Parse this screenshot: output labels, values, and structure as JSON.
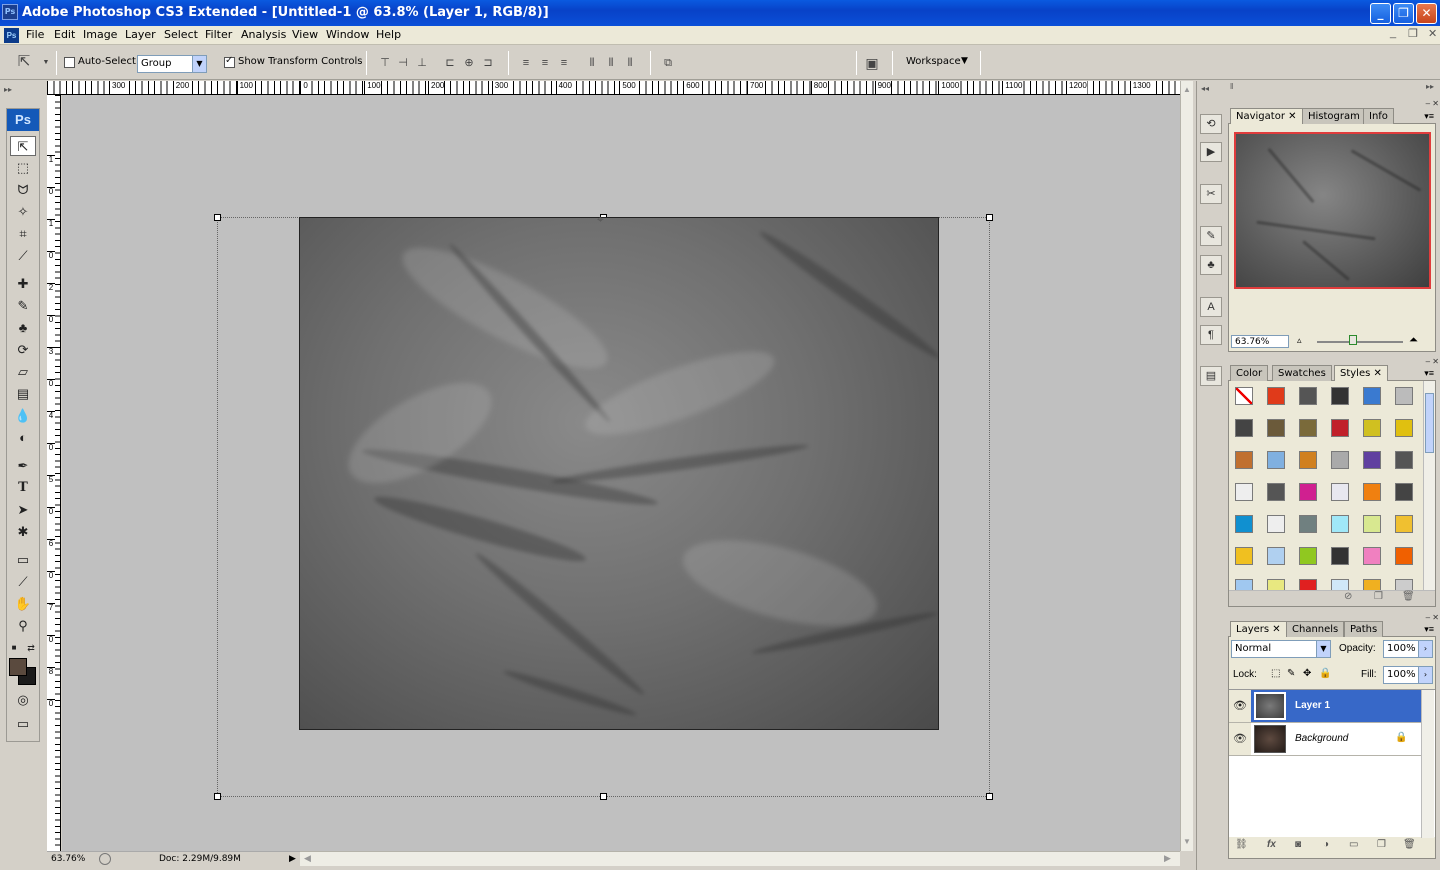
{
  "window": {
    "app_icon": "Ps",
    "title": "Adobe Photoshop CS3 Extended - [Untitled-1 @ 63.8% (Layer 1, RGB/8)]",
    "min": "_",
    "max": "❐",
    "close": "✕"
  },
  "menubar": {
    "icon": "Ps",
    "items": [
      "File",
      "Edit",
      "Image",
      "Layer",
      "Select",
      "Filter",
      "Analysis",
      "View",
      "Window",
      "Help"
    ],
    "mdi_min": "_",
    "mdi_restore": "❐",
    "mdi_close": "✕"
  },
  "options": {
    "auto_select_label": "Auto-Select:",
    "auto_select_checked": false,
    "auto_select_value": "Group",
    "transform_label": "Show Transform Controls",
    "transform_checked": true,
    "workspace_label": "Workspace",
    "dropdown_arrow": "▼"
  },
  "ruler_h": [
    "300",
    "200",
    "100",
    "0",
    "100",
    "200",
    "300",
    "400",
    "500",
    "600",
    "700",
    "800",
    "900",
    "1000",
    "1100",
    "1200",
    "1300"
  ],
  "ruler_v": [
    "1",
    "0",
    "1",
    "0",
    "2",
    "0",
    "3",
    "0",
    "4",
    "0",
    "5",
    "0",
    "6",
    "0",
    "7",
    "0",
    "8",
    "0"
  ],
  "toolbox": {
    "logo": "Ps",
    "foreground_color": "#5a4a3e",
    "background_color": "#1b1b1b"
  },
  "status": {
    "zoom": "63.76%",
    "doc": "Doc: 2.29M/9.89M",
    "arrow": "▶"
  },
  "navigator": {
    "tabs": [
      "Navigator",
      "Histogram",
      "Info"
    ],
    "zoom": "63.76%"
  },
  "swatches_panel": {
    "tabs": [
      "Color",
      "Swatches",
      "Styles"
    ]
  },
  "layers_panel": {
    "tabs": [
      "Layers",
      "Channels",
      "Paths"
    ],
    "blend_mode": "Normal",
    "opacity_label": "Opacity:",
    "opacity_value": "100%",
    "lock_label": "Lock:",
    "fill_label": "Fill:",
    "fill_value": "100%",
    "layers": [
      {
        "name": "Layer 1",
        "selected": true
      },
      {
        "name": "Background",
        "selected": false
      }
    ]
  },
  "colors": {
    "title_bar": "#0a4fd8",
    "canvas_bg": "#c0c0c0",
    "selection": "#3768c8",
    "nav_frame": "#e03c3c"
  }
}
